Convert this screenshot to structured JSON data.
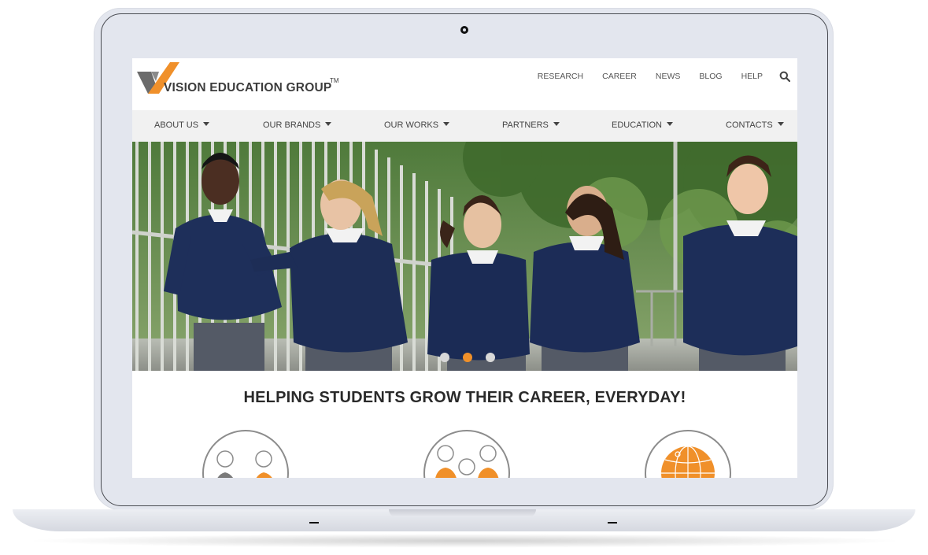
{
  "brand": {
    "name": "VISION EDUCATION GROUP",
    "tm": "TM",
    "accent": "#f0902a",
    "logo_icon": "checkmark-v-logo"
  },
  "top_links": [
    "RESEARCH",
    "CAREER",
    "NEWS",
    "BLOG",
    "HELP"
  ],
  "search": {
    "icon": "search-icon"
  },
  "nav": {
    "items": [
      {
        "label": "ABOUT US"
      },
      {
        "label": "OUR BRANDS"
      },
      {
        "label": "OUR WORKS"
      },
      {
        "label": "PARTNERS"
      },
      {
        "label": "EDUCATION"
      },
      {
        "label": "CONTACTS"
      }
    ]
  },
  "hero": {
    "slides_count": 3,
    "active_slide": 2
  },
  "main": {
    "tagline": "HELPING STUDENTS GROW THEIR CAREER, EVERYDAY!",
    "features": [
      {
        "icon": "mentoring-people-icon"
      },
      {
        "icon": "group-students-icon"
      },
      {
        "icon": "globe-icon"
      }
    ]
  }
}
